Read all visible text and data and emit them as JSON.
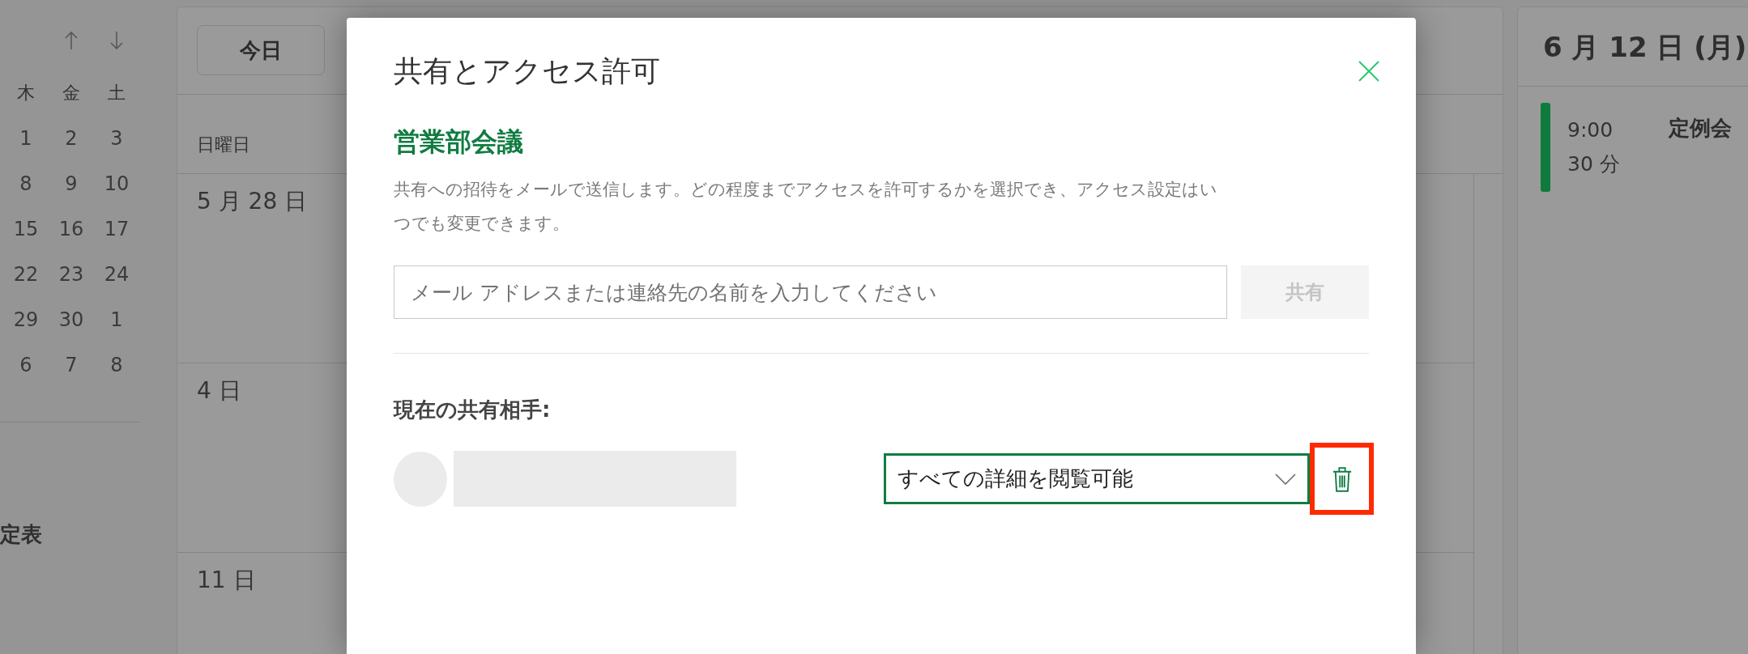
{
  "sidebar": {
    "mini_calendar": {
      "weekdays": [
        "木",
        "金",
        "土"
      ],
      "weeks": [
        [
          "1",
          "2",
          "3"
        ],
        [
          "8",
          "9",
          "10"
        ],
        [
          "15",
          "16",
          "17"
        ],
        [
          "22",
          "23",
          "24"
        ],
        [
          "29",
          "30",
          "1"
        ],
        [
          "6",
          "7",
          "8"
        ]
      ]
    },
    "section_title": "定表"
  },
  "calendar": {
    "today_button": "今日",
    "day_headers": [
      "日曜日"
    ],
    "weeks": [
      {
        "date": "5 月 28 日"
      },
      {
        "date": "4 日"
      },
      {
        "date": "11 日"
      }
    ]
  },
  "agenda": {
    "date": "6 月 12 日 (月)",
    "events": [
      {
        "time": "9:00",
        "duration": "30 分",
        "title": "定例会",
        "color": "#0f7b3b"
      }
    ]
  },
  "dialog": {
    "title": "共有とアクセス許可",
    "event_name": "営業部会議",
    "description": "共有への招待をメールで送信します。どの程度までアクセスを許可するかを選択でき、アクセス設定はいつでも変更できます。",
    "email_field": {
      "placeholder": "メール アドレスまたは連絡先の名前を入力してください"
    },
    "share_button": {
      "label": "共有",
      "disabled": true
    },
    "shared_with_label": "現在の共有相手:",
    "shares": [
      {
        "permission": "すべての詳細を閲覧可能",
        "delete_highlighted": true
      }
    ]
  }
}
